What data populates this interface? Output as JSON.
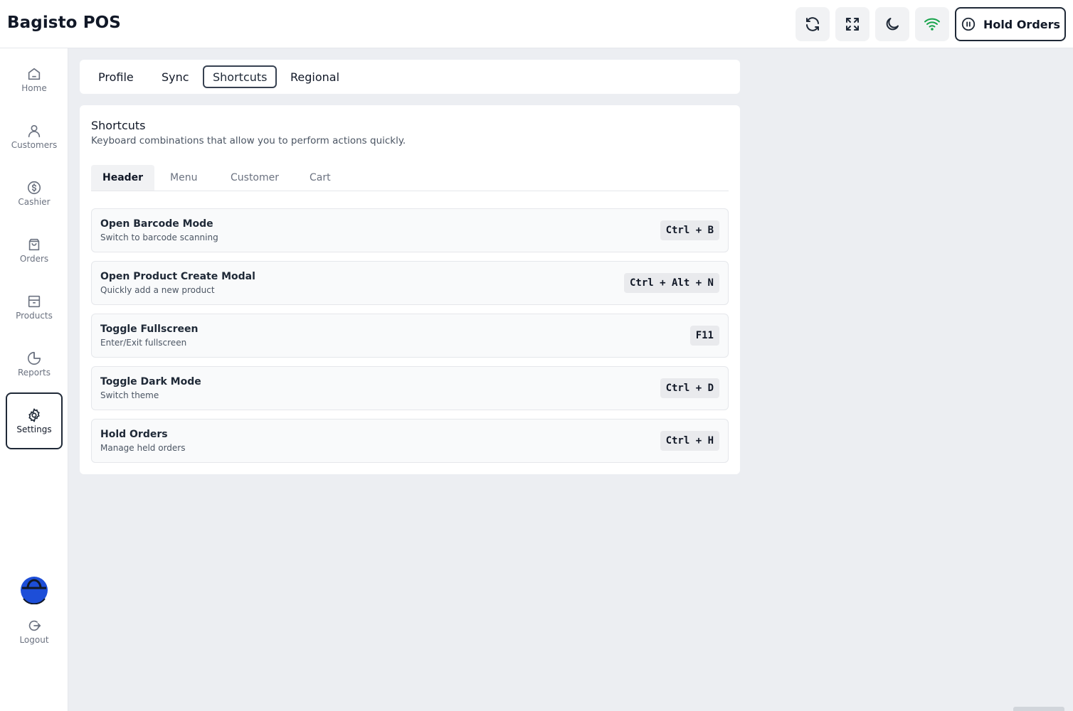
{
  "app": {
    "title": "Bagisto POS"
  },
  "header": {
    "icons": [
      "sync-icon",
      "fullscreen-icon",
      "moon-icon",
      "wifi-icon"
    ],
    "hold_orders_label": "Hold Orders"
  },
  "sidebar": {
    "items": [
      {
        "label": "Home",
        "icon": "home-icon"
      },
      {
        "label": "Customers",
        "icon": "user-icon"
      },
      {
        "label": "Cashier",
        "icon": "dollar-icon"
      },
      {
        "label": "Orders",
        "icon": "bag-icon"
      },
      {
        "label": "Products",
        "icon": "box-icon"
      },
      {
        "label": "Reports",
        "icon": "pie-chart-icon"
      },
      {
        "label": "Settings",
        "icon": "gear-icon",
        "active": true
      }
    ],
    "logout_label": "Logout"
  },
  "settings_tabs": [
    "Profile",
    "Sync",
    "Shortcuts",
    "Regional"
  ],
  "active_settings_tab": "Shortcuts",
  "shortcuts": {
    "title": "Shortcuts",
    "subtitle": "Keyboard combinations that allow you to perform actions quickly.",
    "tabs": [
      "Header",
      "Menu",
      "Customer",
      "Cart"
    ],
    "active_tab": "Header",
    "items": [
      {
        "title": "Open Barcode Mode",
        "desc": "Switch to barcode scanning",
        "keys": "Ctrl + B"
      },
      {
        "title": "Open Product Create Modal",
        "desc": "Quickly add a new product",
        "keys": "Ctrl + Alt + N"
      },
      {
        "title": "Toggle Fullscreen",
        "desc": "Enter/Exit fullscreen",
        "keys": "F11"
      },
      {
        "title": "Toggle Dark Mode",
        "desc": "Switch theme",
        "keys": "Ctrl + D"
      },
      {
        "title": "Hold Orders",
        "desc": "Manage held orders",
        "keys": "Ctrl + H"
      }
    ]
  },
  "colors": {
    "accent": "#1f2937",
    "wifi": "#16a34a",
    "avatar": "#1d4ed8"
  }
}
